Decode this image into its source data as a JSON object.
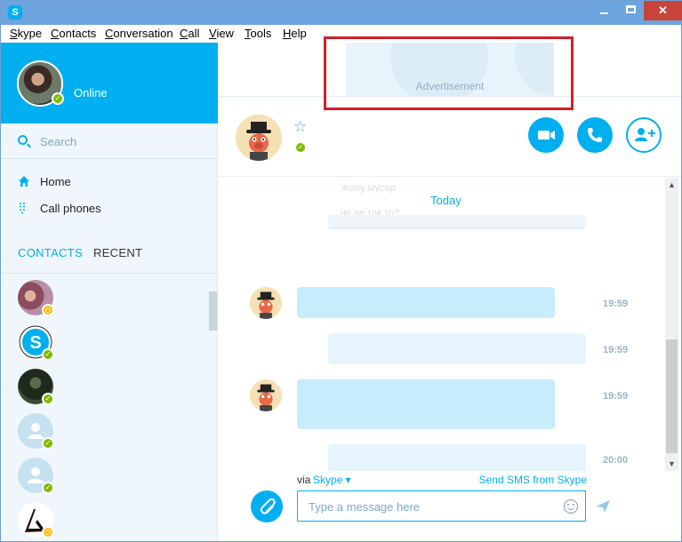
{
  "window": {
    "app_icon": "S",
    "min_icon": "minimize-icon",
    "max_icon": "maximize-icon",
    "close_label": "✕"
  },
  "menu": [
    "Skype",
    "Contacts",
    "Conversation",
    "Call",
    "View",
    "Tools",
    "Help"
  ],
  "profile": {
    "status": "Online"
  },
  "search": {
    "placeholder": "Search"
  },
  "nav": [
    {
      "label": "Home",
      "icon": "home-icon"
    },
    {
      "label": "Call phones",
      "icon": "dialpad-icon"
    }
  ],
  "tabs": {
    "contacts": "CONTACTS",
    "recent": "RECENT"
  },
  "contacts": [
    {
      "status": "away"
    },
    {
      "status": "online"
    },
    {
      "status": "online"
    },
    {
      "status": "online"
    },
    {
      "status": "online"
    },
    {
      "status": "away"
    }
  ],
  "ad": {
    "label": "Advertisement"
  },
  "conversation": {
    "ghost_line_1": "Жопу мусор",
    "ghost_line_2": "че не так то?",
    "date_label": "Today",
    "messages": [
      {
        "time": "19:59",
        "direction": "in"
      },
      {
        "time": "19:59",
        "direction": "out"
      },
      {
        "time": "19:59",
        "direction": "in"
      },
      {
        "time": "20:00",
        "direction": "out"
      }
    ]
  },
  "composer": {
    "via_label": "via",
    "via_service": "Skype ▾",
    "sms_link": "Send SMS from Skype",
    "placeholder": "Type a message here"
  },
  "colors": {
    "accent": "#00aff0",
    "online": "#7dba00",
    "away": "#fdb900",
    "highlight": "#d0202a"
  }
}
